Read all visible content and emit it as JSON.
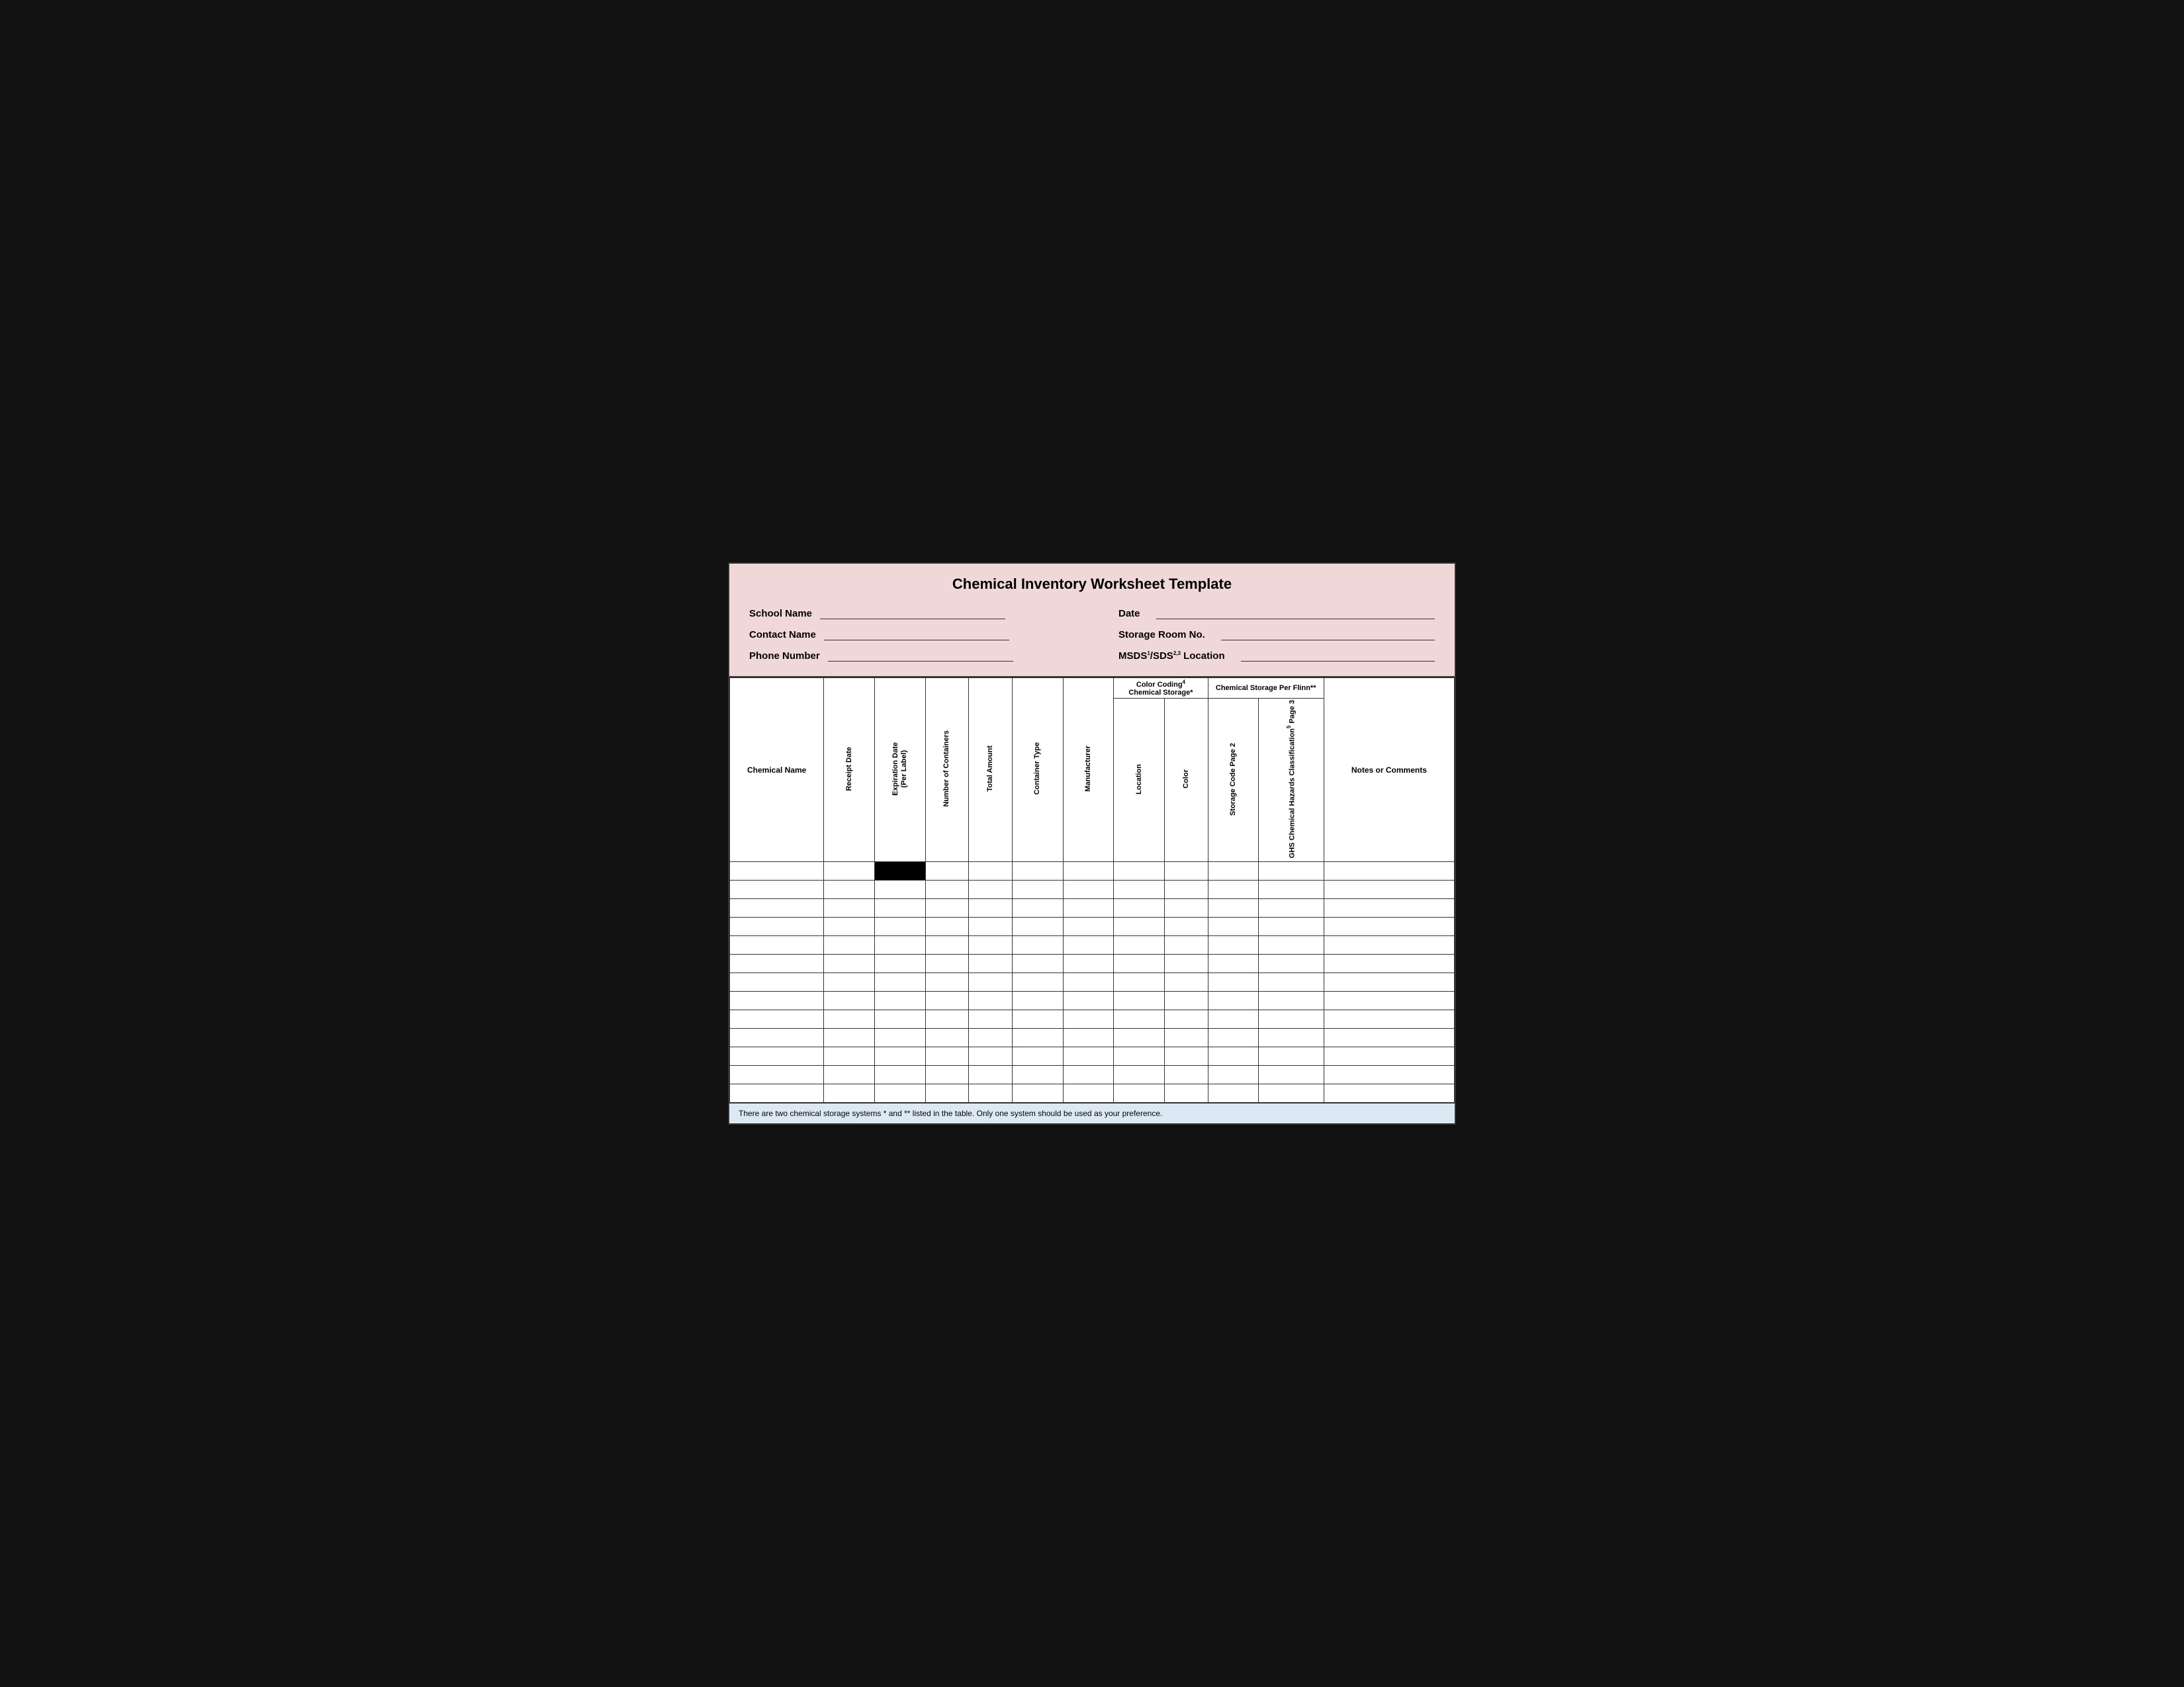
{
  "title": "Chemical Inventory Worksheet Template",
  "form": {
    "school_name_label": "School Name",
    "contact_name_label": "Contact Name",
    "phone_number_label": "Phone Number",
    "date_label": "Date",
    "storage_room_label": "Storage Room No.",
    "msds_label": "MSDS",
    "msds_sup1": "1",
    "sds_label": "/SDS",
    "sds_sup2": "2,3",
    "location_label": "Location"
  },
  "table": {
    "col_chemical_name": "Chemical Name",
    "col_receipt_date": "Receipt Date",
    "col_expiration_date": "Expiration Date (Per Label)",
    "col_num_containers": "Number of Containers",
    "col_total_amount": "Total Amount",
    "col_container_type": "Container Type",
    "col_manufacturer": "Manufacturer",
    "color_coding_header": "Color Coding",
    "color_coding_sup": "4",
    "color_coding_sub": "Chemical Storage*",
    "col_location": "Location",
    "col_color": "Color",
    "chemical_storage_header": "Chemical Storage Per Flinn**",
    "col_storage_code": "Storage Code Page 2",
    "col_ghs": "GHS Chemical Hazards Classification",
    "col_ghs_sup": "5",
    "col_ghs_page": "Page 3",
    "col_notes": "Notes or Comments"
  },
  "footer": "There are two chemical storage systems * and ** listed in the table. Only one system should be used as your preference.",
  "num_data_rows": 13
}
